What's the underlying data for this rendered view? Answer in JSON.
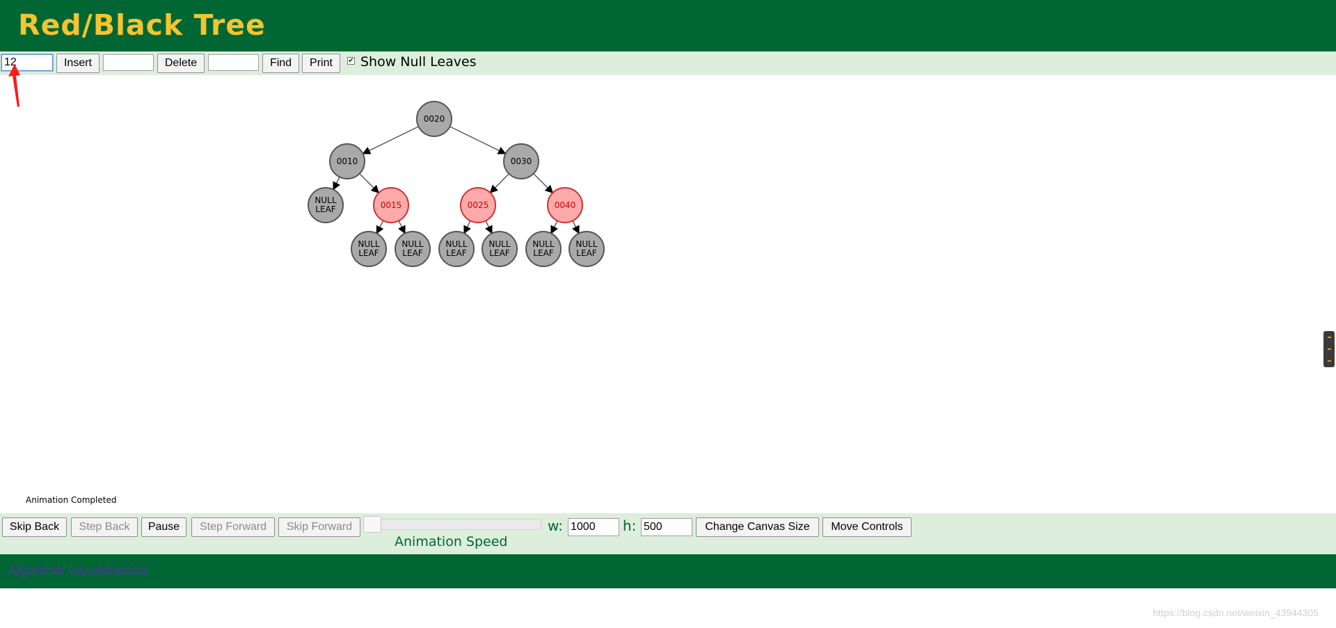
{
  "header": {
    "title": "Red/Black Tree"
  },
  "toolbar": {
    "insert_input_value": "12",
    "insert_label": "Insert",
    "delete_input_value": "",
    "delete_label": "Delete",
    "find_input_value": "",
    "find_label": "Find",
    "print_label": "Print",
    "show_null_leaves_label": "Show Null Leaves",
    "show_null_leaves_checked": true
  },
  "tree": {
    "null_label_line1": "NULL",
    "null_label_line2": "LEAF",
    "node_colors": {
      "black": "#a9a9a9",
      "red": "#ffaaaa",
      "red_text": "#cc0000"
    },
    "nodes": [
      {
        "key": "0020",
        "color": "black"
      },
      {
        "key": "0010",
        "color": "black"
      },
      {
        "key": "0030",
        "color": "black"
      },
      {
        "key": "0015",
        "color": "red"
      },
      {
        "key": "0025",
        "color": "red"
      },
      {
        "key": "0040",
        "color": "red"
      }
    ]
  },
  "status": {
    "text": "Animation Completed"
  },
  "animation_controls": {
    "skip_back": "Skip Back",
    "step_back": "Step Back",
    "pause": "Pause",
    "step_forward": "Step Forward",
    "skip_forward": "Skip Forward",
    "speed_label": "Animation Speed",
    "w_label": "w:",
    "w_value": "1000",
    "h_label": "h:",
    "h_value": "500",
    "change_canvas_size": "Change Canvas Size",
    "move_controls": "Move Controls"
  },
  "footer": {
    "link_text": "Algorithm Visualizations"
  },
  "watermark": {
    "text": "https://blog.csdn.net/weixin_43944305"
  },
  "colors": {
    "header_bg": "#006633",
    "title": "#f4c430",
    "controls_bg": "#ddeedd",
    "annotation_arrow": "#ff1a1a"
  }
}
